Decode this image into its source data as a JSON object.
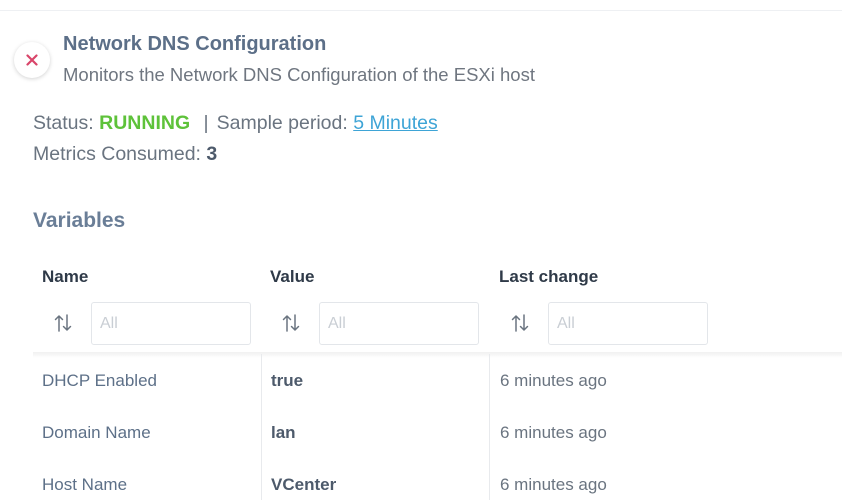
{
  "header": {
    "title": "Network DNS Configuration",
    "subtitle": "Monitors the Network DNS Configuration of the ESXi host"
  },
  "status": {
    "label": "Status:",
    "value": "RUNNING",
    "value_color": "#5ec23a",
    "separator": "|",
    "sample_label": "Sample period:",
    "sample_value": "5 Minutes"
  },
  "metrics": {
    "label": "Metrics Consumed:",
    "value": "3"
  },
  "variables": {
    "title": "Variables",
    "columns": [
      {
        "label": "Name",
        "filter_placeholder": "All"
      },
      {
        "label": "Value",
        "filter_placeholder": "All"
      },
      {
        "label": "Last change",
        "filter_placeholder": "All"
      }
    ],
    "rows": [
      {
        "name": "DHCP Enabled",
        "value": "true",
        "last_change": "6 minutes ago"
      },
      {
        "name": "Domain Name",
        "value": "lan",
        "last_change": "6 minutes ago"
      },
      {
        "name": "Host Name",
        "value": "VCenter",
        "last_change": "6 minutes ago"
      }
    ]
  },
  "colors": {
    "accent_link": "#3ea4d6",
    "close_icon": "#d9456a",
    "title": "#5c6f88"
  },
  "icons": {
    "close": "close-icon",
    "sort": "sort-arrows-icon"
  }
}
